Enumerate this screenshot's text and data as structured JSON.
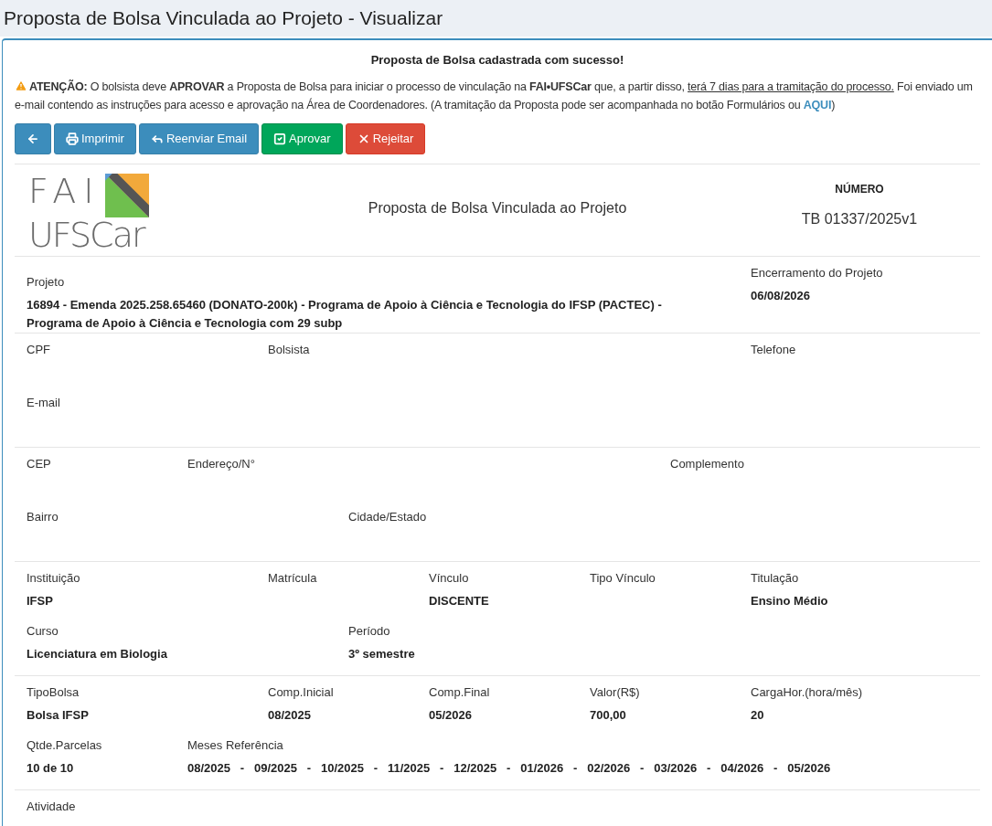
{
  "page_title": "Proposta de Bolsa Vinculada ao Projeto - Visualizar",
  "success_message": "Proposta de Bolsa cadastrada com sucesso!",
  "alert": {
    "text_before": "**ATENÇÃO:** O bolsista deve **APROVAR** a Proposta de Bolsa para iniciar o processo de vinculação na **FAI•UFSCar** que, a partir disso, ",
    "underlined": "terá 7 dias para a tramitação do processo.",
    "text_after": " Foi enviado um e-mail contendo as instruções para acesso e aprovação na Área de Coordenadores. (A tramitação da Proposta pode ser acompanhada no botão Formulários ou ",
    "link": "AQUI",
    "text_end": ")"
  },
  "buttons": [
    {
      "kind": "back"
    },
    {
      "kind": "print",
      "label": "Imprimir"
    },
    {
      "kind": "resend",
      "label": "Reenviar Email"
    },
    {
      "kind": "approve",
      "label": "Aprovar"
    },
    {
      "kind": "reject",
      "label": "Rejeitar"
    }
  ],
  "document": {
    "logo": {
      "line1": "FAI",
      "line2": "UFSCar"
    },
    "title": "Proposta de Bolsa Vinculada ao Projeto",
    "number_label": "NÚMERO",
    "number": "TB 01337/2025v1"
  },
  "sections": [
    {
      "rows": [
        [
          {
            "label": "Projeto",
            "value": "16894 - Emenda 2025.258.65460 (DONATO-200k) - Programa de Apoio à Ciência e Tecnologia do IFSP (PACTEC) - Programa de Apoio à Ciência e Tecnologia com 29 subp"
          },
          {
            "label": "Encerramento do Projeto",
            "value": "06/08/2026"
          }
        ]
      ]
    },
    {
      "rows": [
        [
          {
            "label": "CPF"
          },
          {
            "label": "Bolsista"
          },
          {
            "label": "Telefone"
          }
        ],
        [
          {
            "label": "E-mail"
          }
        ]
      ]
    },
    {
      "rows": [
        [
          {
            "label": "CEP"
          },
          {
            "label": "Endereço/N°"
          },
          {
            "label": "Complemento"
          }
        ],
        [
          {
            "label": "Bairro"
          },
          {
            "label": "Cidade/Estado"
          }
        ]
      ]
    },
    {
      "rows": [
        [
          {
            "label": "Instituição",
            "value": "IFSP"
          },
          {
            "label": "Matrícula"
          },
          {
            "label": "Vínculo",
            "value": "DISCENTE"
          },
          {
            "label": "Tipo Vínculo"
          },
          {
            "label": "Titulação",
            "value": "Ensino Médio"
          }
        ],
        [
          {
            "label": "Curso",
            "value": "Licenciatura em Biologia"
          },
          {
            "label": "Período",
            "value": "3º semestre"
          }
        ]
      ]
    },
    {
      "rows": [
        [
          {
            "label": "TipoBolsa",
            "value": "Bolsa IFSP"
          },
          {
            "label": "Comp.Inicial",
            "value": "08/2025"
          },
          {
            "label": "Comp.Final",
            "value": "05/2026"
          },
          {
            "label": "Valor(R$)",
            "value": "700,00"
          },
          {
            "label": "CargaHor.(hora/mês)",
            "value": "20"
          }
        ],
        [
          {
            "label": "Qtde.Parcelas",
            "value": "10 de 10"
          },
          {
            "label": "Meses Referência",
            "value": "08/2025   -   09/2025   -   10/2025   -   11/2025   -   12/2025   -   01/2026   -   02/2026   -   03/2026   -   04/2026   -   05/2026"
          }
        ]
      ]
    },
    {
      "rows": [
        [
          {
            "label": "Atividade"
          }
        ]
      ]
    }
  ]
}
